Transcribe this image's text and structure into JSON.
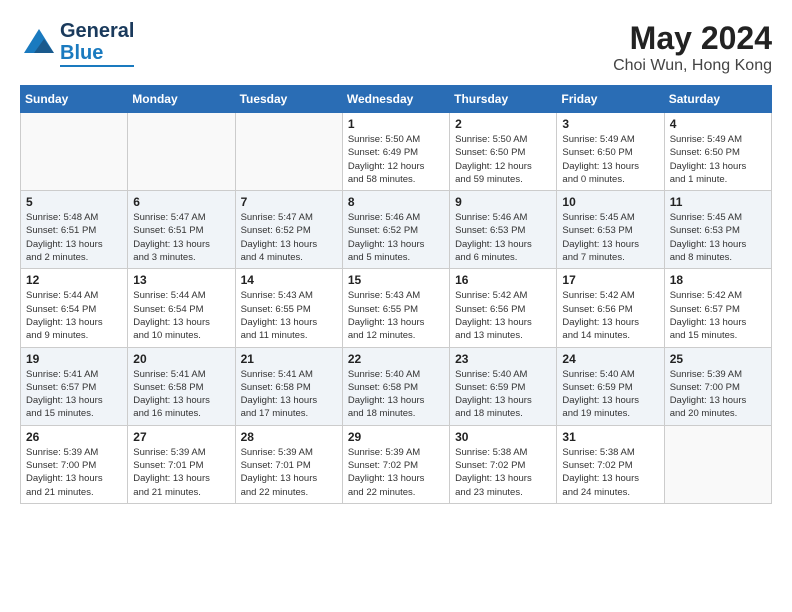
{
  "header": {
    "logo_line1": "General",
    "logo_line2": "Blue",
    "title": "May 2024",
    "subtitle": "Choi Wun, Hong Kong"
  },
  "weekdays": [
    "Sunday",
    "Monday",
    "Tuesday",
    "Wednesday",
    "Thursday",
    "Friday",
    "Saturday"
  ],
  "weeks": [
    [
      {
        "num": "",
        "info": ""
      },
      {
        "num": "",
        "info": ""
      },
      {
        "num": "",
        "info": ""
      },
      {
        "num": "1",
        "info": "Sunrise: 5:50 AM\nSunset: 6:49 PM\nDaylight: 12 hours\nand 58 minutes."
      },
      {
        "num": "2",
        "info": "Sunrise: 5:50 AM\nSunset: 6:50 PM\nDaylight: 12 hours\nand 59 minutes."
      },
      {
        "num": "3",
        "info": "Sunrise: 5:49 AM\nSunset: 6:50 PM\nDaylight: 13 hours\nand 0 minutes."
      },
      {
        "num": "4",
        "info": "Sunrise: 5:49 AM\nSunset: 6:50 PM\nDaylight: 13 hours\nand 1 minute."
      }
    ],
    [
      {
        "num": "5",
        "info": "Sunrise: 5:48 AM\nSunset: 6:51 PM\nDaylight: 13 hours\nand 2 minutes."
      },
      {
        "num": "6",
        "info": "Sunrise: 5:47 AM\nSunset: 6:51 PM\nDaylight: 13 hours\nand 3 minutes."
      },
      {
        "num": "7",
        "info": "Sunrise: 5:47 AM\nSunset: 6:52 PM\nDaylight: 13 hours\nand 4 minutes."
      },
      {
        "num": "8",
        "info": "Sunrise: 5:46 AM\nSunset: 6:52 PM\nDaylight: 13 hours\nand 5 minutes."
      },
      {
        "num": "9",
        "info": "Sunrise: 5:46 AM\nSunset: 6:53 PM\nDaylight: 13 hours\nand 6 minutes."
      },
      {
        "num": "10",
        "info": "Sunrise: 5:45 AM\nSunset: 6:53 PM\nDaylight: 13 hours\nand 7 minutes."
      },
      {
        "num": "11",
        "info": "Sunrise: 5:45 AM\nSunset: 6:53 PM\nDaylight: 13 hours\nand 8 minutes."
      }
    ],
    [
      {
        "num": "12",
        "info": "Sunrise: 5:44 AM\nSunset: 6:54 PM\nDaylight: 13 hours\nand 9 minutes."
      },
      {
        "num": "13",
        "info": "Sunrise: 5:44 AM\nSunset: 6:54 PM\nDaylight: 13 hours\nand 10 minutes."
      },
      {
        "num": "14",
        "info": "Sunrise: 5:43 AM\nSunset: 6:55 PM\nDaylight: 13 hours\nand 11 minutes."
      },
      {
        "num": "15",
        "info": "Sunrise: 5:43 AM\nSunset: 6:55 PM\nDaylight: 13 hours\nand 12 minutes."
      },
      {
        "num": "16",
        "info": "Sunrise: 5:42 AM\nSunset: 6:56 PM\nDaylight: 13 hours\nand 13 minutes."
      },
      {
        "num": "17",
        "info": "Sunrise: 5:42 AM\nSunset: 6:56 PM\nDaylight: 13 hours\nand 14 minutes."
      },
      {
        "num": "18",
        "info": "Sunrise: 5:42 AM\nSunset: 6:57 PM\nDaylight: 13 hours\nand 15 minutes."
      }
    ],
    [
      {
        "num": "19",
        "info": "Sunrise: 5:41 AM\nSunset: 6:57 PM\nDaylight: 13 hours\nand 15 minutes."
      },
      {
        "num": "20",
        "info": "Sunrise: 5:41 AM\nSunset: 6:58 PM\nDaylight: 13 hours\nand 16 minutes."
      },
      {
        "num": "21",
        "info": "Sunrise: 5:41 AM\nSunset: 6:58 PM\nDaylight: 13 hours\nand 17 minutes."
      },
      {
        "num": "22",
        "info": "Sunrise: 5:40 AM\nSunset: 6:58 PM\nDaylight: 13 hours\nand 18 minutes."
      },
      {
        "num": "23",
        "info": "Sunrise: 5:40 AM\nSunset: 6:59 PM\nDaylight: 13 hours\nand 18 minutes."
      },
      {
        "num": "24",
        "info": "Sunrise: 5:40 AM\nSunset: 6:59 PM\nDaylight: 13 hours\nand 19 minutes."
      },
      {
        "num": "25",
        "info": "Sunrise: 5:39 AM\nSunset: 7:00 PM\nDaylight: 13 hours\nand 20 minutes."
      }
    ],
    [
      {
        "num": "26",
        "info": "Sunrise: 5:39 AM\nSunset: 7:00 PM\nDaylight: 13 hours\nand 21 minutes."
      },
      {
        "num": "27",
        "info": "Sunrise: 5:39 AM\nSunset: 7:01 PM\nDaylight: 13 hours\nand 21 minutes."
      },
      {
        "num": "28",
        "info": "Sunrise: 5:39 AM\nSunset: 7:01 PM\nDaylight: 13 hours\nand 22 minutes."
      },
      {
        "num": "29",
        "info": "Sunrise: 5:39 AM\nSunset: 7:02 PM\nDaylight: 13 hours\nand 22 minutes."
      },
      {
        "num": "30",
        "info": "Sunrise: 5:38 AM\nSunset: 7:02 PM\nDaylight: 13 hours\nand 23 minutes."
      },
      {
        "num": "31",
        "info": "Sunrise: 5:38 AM\nSunset: 7:02 PM\nDaylight: 13 hours\nand 24 minutes."
      },
      {
        "num": "",
        "info": ""
      }
    ]
  ]
}
